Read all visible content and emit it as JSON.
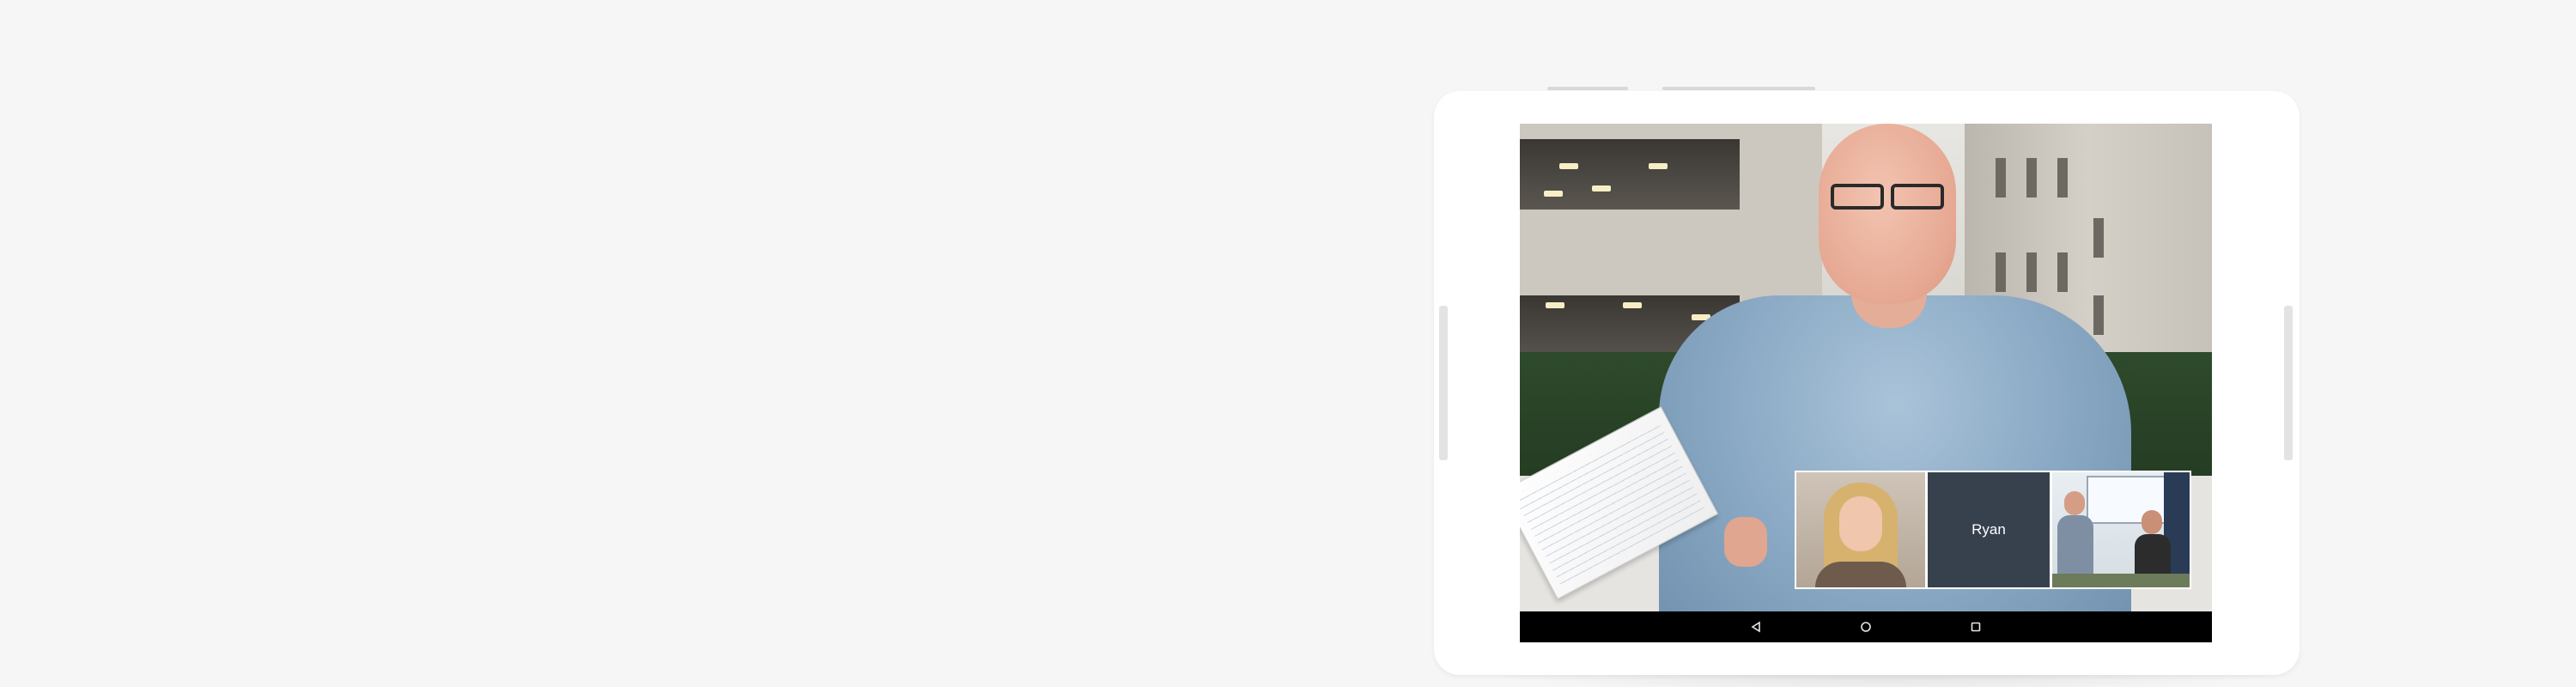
{
  "participants": [
    {
      "name": "",
      "kind": "camera"
    },
    {
      "name": "Ryan",
      "kind": "name-tile"
    },
    {
      "name": "",
      "kind": "room-camera"
    }
  ],
  "nav": {
    "back": "back-icon",
    "home": "home-icon",
    "recents": "recents-icon"
  },
  "colors": {
    "page_background": "#f6f6f6",
    "device": "#ffffff",
    "navbar": "#000000",
    "name_tile": "#37414e"
  }
}
